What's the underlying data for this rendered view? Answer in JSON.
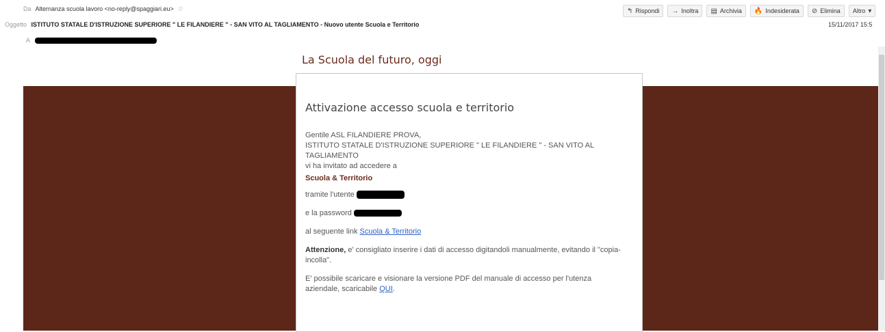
{
  "header": {
    "from_label": "Da",
    "from_value": "Alternanza scuola lavoro <no-reply@spaggiari.eu>",
    "subject_label": "Oggetto",
    "subject_value": "ISTITUTO STATALE D'ISTRUZIONE SUPERIORE \" LE FILANDIERE \" - SAN VITO AL TAGLIAMENTO - Nuovo utente Scuola e Territorio",
    "to_label": "A",
    "date": "15/11/2017 15:5"
  },
  "actions": [
    {
      "label": "Rispondi",
      "icon": "reply-icon"
    },
    {
      "label": "Inoltra",
      "icon": "forward-icon"
    },
    {
      "label": "Archivia",
      "icon": "archive-icon"
    },
    {
      "label": "Indesiderata",
      "icon": "junk-icon"
    },
    {
      "label": "Elimina",
      "icon": "delete-icon"
    },
    {
      "label": "Altro",
      "icon": "chevron-down-icon"
    }
  ],
  "email": {
    "tagline": "La Scuola del futuro, oggi",
    "title": "Attivazione accesso scuola e territorio",
    "greeting": "Gentile ASL FILANDIERE PROVA,",
    "institute": "ISTITUTO STATALE D'ISTRUZIONE SUPERIORE \" LE FILANDIERE \" - SAN VITO AL TAGLIAMENTO",
    "invite": "vi ha invitato ad accedere a",
    "brand": "Scuola & Territorio",
    "user_label": "tramite l'utente",
    "password_label": "e la password",
    "link_prefix": "al seguente link",
    "link_text": "Scuola & Territorio",
    "warning_strong": "Attenzione,",
    "warning_text": " e' consigliato inserire i dati di accesso digitandoli manualmente, evitando il \"copia-incolla\".",
    "pdf_text": "E' possibile scaricare e visionare la versione PDF del manuale di accesso per l'utenza aziendale, scaricabile",
    "pdf_link": "QUI",
    "pdf_end": "."
  },
  "colors": {
    "brown_band": "#5c2619",
    "brand_text": "#6b2b1c",
    "link": "#2a62c9"
  }
}
